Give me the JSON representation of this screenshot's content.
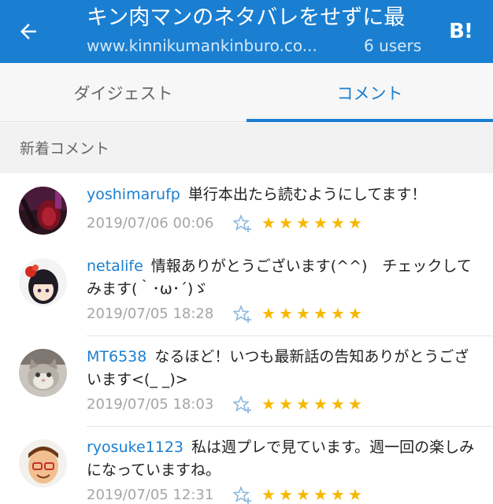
{
  "header": {
    "title": "キン肉マンのネタバレをせずに最",
    "url": "www.kinnikumankinburo.co...",
    "users": "6 users",
    "bookmark_label": "B!"
  },
  "tabs": [
    {
      "label": "ダイジェスト"
    },
    {
      "label": "コメント"
    }
  ],
  "section": {
    "title": "新着コメント"
  },
  "comments": [
    {
      "user": "yoshimarufp",
      "text": "単行本出たら読むようにしてます！",
      "date": "2019/07/06 00:06",
      "stars": 6
    },
    {
      "user": "netalife",
      "text": "情報ありがとうございます(^^)　チェックしてみます(｀･ω･´)ゞ",
      "date": "2019/07/05 18:28",
      "stars": 6
    },
    {
      "user": "MT6538",
      "text": "なるほど！いつも最新話の告知ありがとうございます<(_ _)>",
      "date": "2019/07/05 18:03",
      "stars": 6
    },
    {
      "user": "ryosuke1123",
      "text": "私は週プレで見ています。週一回の楽しみになっていますね。",
      "date": "2019/07/05 12:31",
      "stars": 6
    }
  ],
  "colors": {
    "primary": "#1a7fd1",
    "star": "#f5b800",
    "date": "#a5a5a5"
  }
}
